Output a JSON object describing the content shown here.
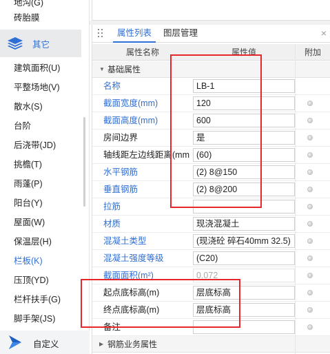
{
  "sidebar": {
    "items_top": [
      "地沟(G)",
      "砖胎膜"
    ],
    "group_label": "其它",
    "items": [
      "建筑面积(U)",
      "平整场地(V)",
      "散水(S)",
      "台阶",
      "后浇带(JD)",
      "挑檐(T)",
      "雨蓬(P)",
      "阳台(Y)",
      "屋面(W)",
      "保温层(H)",
      "栏板(K)",
      "压顶(YD)",
      "栏杆扶手(G)",
      "脚手架(JS)"
    ],
    "active_item": "栏板(K)",
    "footer_label": "自定义"
  },
  "panel": {
    "tabs": [
      "属性列表",
      "图层管理"
    ],
    "close": "×",
    "headers": {
      "name": "属性名称",
      "value": "属性值",
      "extra": "附加"
    },
    "section_basic": "基础属性",
    "section_rebar": "钢筋业务属性",
    "rows": [
      {
        "name": "名称",
        "value": "LB-1",
        "blue": true,
        "dot": false
      },
      {
        "name": "截面宽度(mm)",
        "value": "120",
        "blue": true,
        "dot": true
      },
      {
        "name": "截面高度(mm)",
        "value": "600",
        "blue": true,
        "dot": true
      },
      {
        "name": "房间边界",
        "value": "是",
        "blue": false,
        "dot": true
      },
      {
        "name": "轴线距左边线距离(mm)",
        "value": "(60)",
        "blue": false,
        "dot": true
      },
      {
        "name": "水平钢筋",
        "value": "(2) 8@150",
        "blue": true,
        "dot": true
      },
      {
        "name": "垂直钢筋",
        "value": "(2) 8@200",
        "blue": true,
        "dot": true
      },
      {
        "name": "拉筋",
        "value": "",
        "blue": true,
        "dot": true
      },
      {
        "name": "材质",
        "value": "现浇混凝土",
        "blue": true,
        "dot": true
      },
      {
        "name": "混凝土类型",
        "value": "(现浇砼 碎石40mm 32.5)",
        "blue": true,
        "dot": true
      },
      {
        "name": "混凝土强度等级",
        "value": "(C20)",
        "blue": true,
        "dot": true
      },
      {
        "name": "截面面积(m²)",
        "value": "0.072",
        "blue": true,
        "dot": true,
        "gray": true
      },
      {
        "name": "起点底标高(m)",
        "value": "层底标高",
        "blue": false,
        "dot": true
      },
      {
        "name": "终点底标高(m)",
        "value": "层底标高",
        "blue": false,
        "dot": true
      },
      {
        "name": "备注",
        "value": "",
        "blue": false,
        "dot": true
      }
    ]
  },
  "colors": {
    "accent": "#2f6fd4",
    "highlight": "#e5262b"
  }
}
